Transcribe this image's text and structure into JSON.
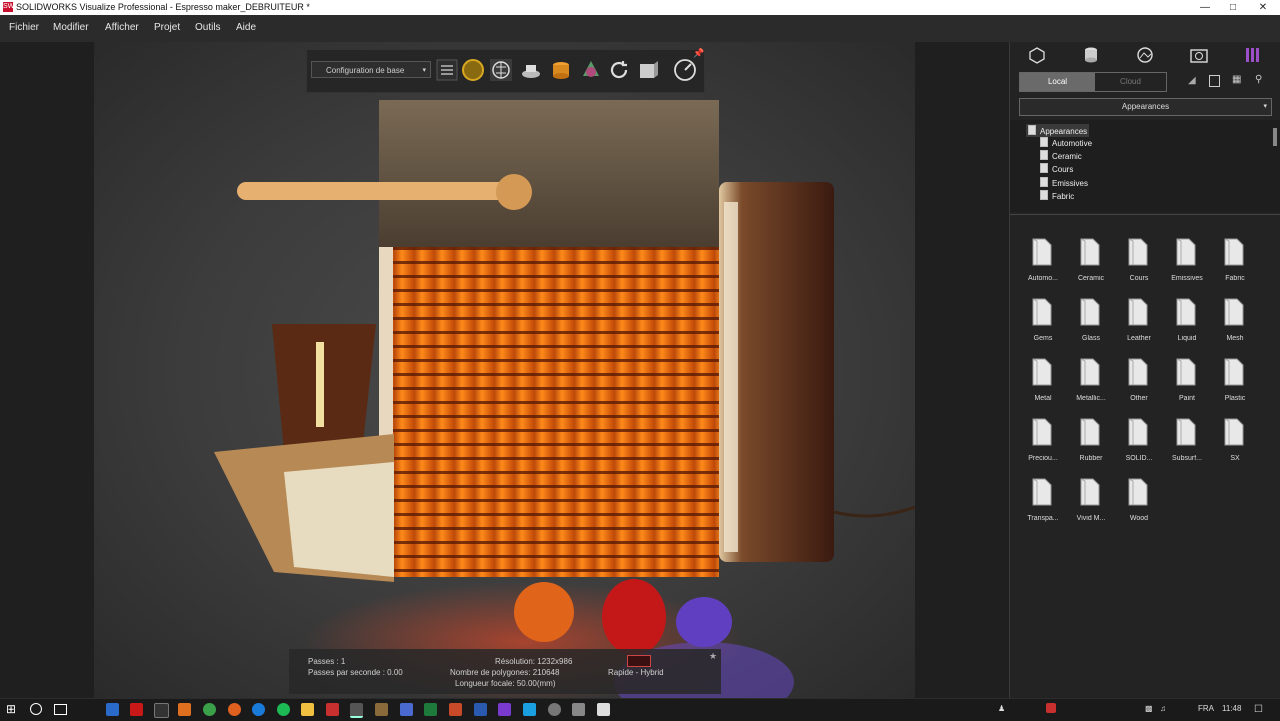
{
  "window": {
    "title": "SOLIDWORKS Visualize Professional - Espresso maker_DEBRUITEUR *",
    "app_icon": "SW"
  },
  "menu": [
    "Fichier",
    "Modifier",
    "Afficher",
    "Projet",
    "Outils",
    "Aide"
  ],
  "toolbar": {
    "configuration": "Configuration de base"
  },
  "status": {
    "passes": "Passes : 1",
    "passes_per_second": "Passes par seconde : 0.00",
    "resolution": "Résolution: 1232x986",
    "polygons": "Nombre de polygones: 210648",
    "focal": "Longueur focale: 50.00(mm)",
    "mode": "Rapide - Hybrid"
  },
  "panel": {
    "local_label": "Local",
    "cloud_label": "Cloud",
    "dropdown": "Appearances",
    "tree": [
      "Appearances",
      "Automotive",
      "Ceramic",
      "Cours",
      "Emissives",
      "Fabric"
    ],
    "tiles": [
      "Automo...",
      "Ceramic",
      "Cours",
      "Emissives",
      "Fabric",
      "Gems",
      "Glass",
      "Leather",
      "Liquid",
      "Mesh",
      "Metal",
      "Metallic...",
      "Other",
      "Paint",
      "Plastic",
      "Preciou...",
      "Rubber",
      "SOLID...",
      "Subsurf...",
      "SX",
      "Transpa...",
      "Vivid M...",
      "Wood"
    ]
  },
  "taskbar": {
    "lang": "FRA",
    "time": "11:48"
  },
  "colors": {
    "accent_purple": "#9b4fc8",
    "menu_bg": "#2b2b2b",
    "panel_bg": "#232323"
  }
}
